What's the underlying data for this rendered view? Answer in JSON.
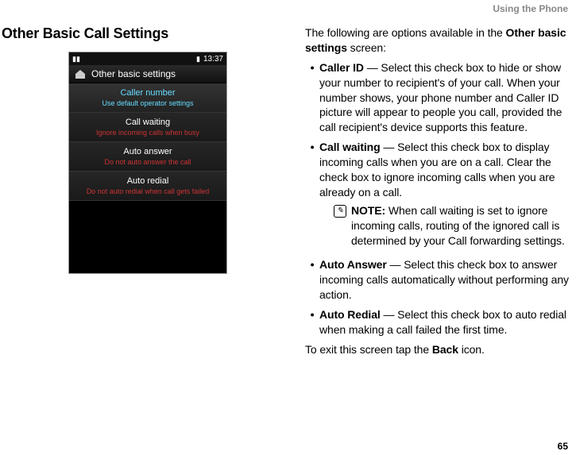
{
  "header": {
    "running": "Using the Phone"
  },
  "page_number": "65",
  "left": {
    "title": "Other Basic Call Settings",
    "phone": {
      "time": "13:37",
      "screen_title": "Other basic settings",
      "rows": [
        {
          "title": "Caller number",
          "sub": "Use default operator settings",
          "selected": true
        },
        {
          "title": "Call waiting",
          "sub": "Ignore incoming calls when busy",
          "selected": false
        },
        {
          "title": "Auto answer",
          "sub": "Do not auto answer the call",
          "selected": false
        },
        {
          "title": "Auto redial",
          "sub": "Do not auto redial when call gets failed",
          "selected": false
        }
      ]
    }
  },
  "right": {
    "intro_a": "The following are options available in the ",
    "intro_bold": "Other basic settings",
    "intro_b": " screen:",
    "bullets": [
      {
        "label": "Caller ID",
        "text": " — Select this check box to hide or show your number to recipient's of your call. When your number shows, your phone number and Caller ID picture will appear to people you call, provided the call recipient's device supports this feature."
      },
      {
        "label": "Call waiting",
        "text": " — Select this check box to display incoming calls when you are on a call. Clear the check box to ignore incoming calls when you are already on a call."
      },
      {
        "label": "Auto Answer",
        "text": " — Select this check box to answer incoming calls automatically without performing any action."
      },
      {
        "label": "Auto Redial",
        "text": " — Select this check box to auto redial when making a call failed the first time."
      }
    ],
    "note_label": "NOTE:",
    "note_text": " When call waiting is set to ignore incoming calls, routing of the ignored call is determined by your Call forwarding settings.",
    "closing_a": "To exit this screen tap the ",
    "closing_bold": "Back",
    "closing_b": " icon."
  }
}
